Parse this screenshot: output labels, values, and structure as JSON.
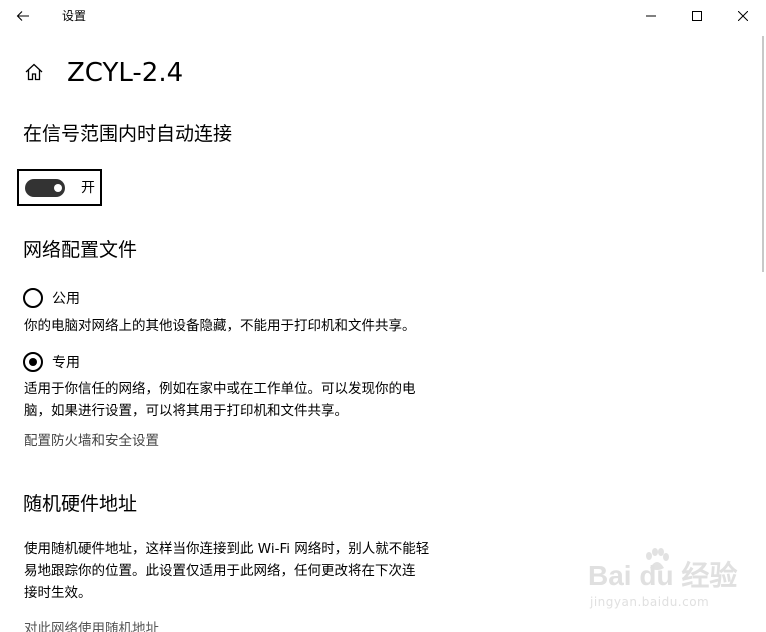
{
  "window": {
    "title": "设置"
  },
  "header": {
    "network_name": "ZCYL-2.4"
  },
  "auto_connect": {
    "heading": "在信号范围内时自动连接",
    "toggle_state_label": "开",
    "toggle_on": true
  },
  "network_profile": {
    "heading": "网络配置文件",
    "options": [
      {
        "label": "公用",
        "selected": false,
        "description_lines": [
          "你的电脑对网络上的其他设备隐藏，不能用于打印机和文件共享。"
        ]
      },
      {
        "label": "专用",
        "selected": true,
        "description_lines": [
          "适用于你信任的网络，例如在家中或在工作单位。可以发现你的电",
          "脑，如果进行设置，可以将其用于打印机和文件共享。"
        ]
      }
    ],
    "firewall_link": "配置防火墙和安全设置"
  },
  "random_hardware": {
    "heading": "随机硬件地址",
    "description_lines": [
      "使用随机硬件地址，这样当你连接到此 Wi-Fi 网络时，别人就不能轻",
      "易地跟踪你的位置。此设置仅适用于此网络，任何更改将在下次连",
      "接时生效。"
    ],
    "cutoff_text": "对此网络使用随机地址"
  },
  "watermark": {
    "logo_text": "Bai du 经验",
    "url": "jingyan.baidu.com"
  },
  "icons": {
    "back": "back-arrow-icon",
    "minimize": "minimize-icon",
    "maximize": "maximize-icon",
    "close": "close-icon",
    "home": "home-icon"
  }
}
